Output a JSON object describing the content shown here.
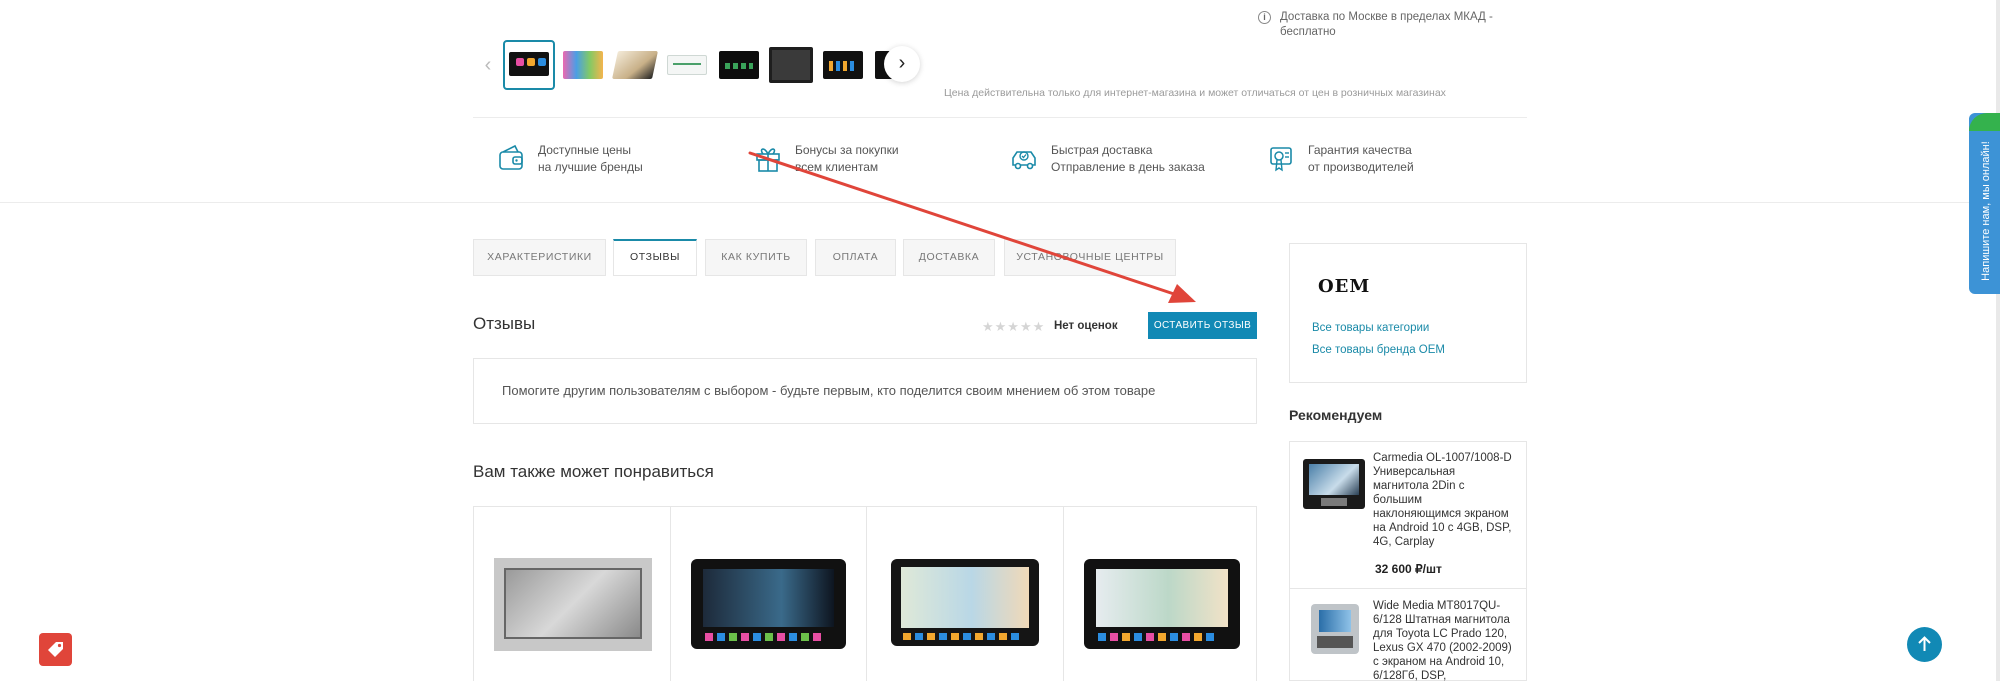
{
  "delivery": {
    "text": "Доставка по Москве в пределах МКАД - бесплатно"
  },
  "price_note": "Цена действительна только для интернет-магазина и может отличаться от цен в розничных магазинах",
  "advantages": [
    {
      "icon": "wallet-icon",
      "line1": "Доступные цены",
      "line2": "на лучшие бренды"
    },
    {
      "icon": "gift-icon",
      "line1": "Бонусы за покупки",
      "line2": "всем клиентам"
    },
    {
      "icon": "delivery-car-icon",
      "line1": "Быстрая доставка",
      "line2": "Отправление в день заказа"
    },
    {
      "icon": "quality-guarantee-icon",
      "line1": "Гарантия качества",
      "line2": "от производителей"
    }
  ],
  "tabs": [
    {
      "label": "ХАРАКТЕРИСТИКИ"
    },
    {
      "label": "ОТЗЫВЫ"
    },
    {
      "label": "КАК КУПИТЬ"
    },
    {
      "label": "ОПЛАТА"
    },
    {
      "label": "ДОСТАВКА"
    },
    {
      "label": "УСТАНОВОЧНЫЕ ЦЕНТРЫ"
    }
  ],
  "reviews": {
    "title": "Отзывы",
    "stars": "★★★★★",
    "no_ratings": "Нет оценок",
    "leave_button": "ОСТАВИТЬ ОТЗЫВ",
    "empty_text": "Помогите другим пользователям с выбором - будьте первым, кто поделится своим мнением об этом товаре"
  },
  "also_like": {
    "title": "Вам также может понравиться"
  },
  "brand": {
    "logo_text": "OEM",
    "links": [
      "Все товары категории",
      "Все товары бренда OEM"
    ]
  },
  "recommend": {
    "title": "Рекомендуем",
    "items": [
      {
        "name": "Carmedia OL-1007/1008-D Универсальная магнитола 2Din с большим наклоняющимся экраном на Android 10 с 4GB, DSP, 4G, Carplay",
        "price": "32 600 ₽/шт"
      },
      {
        "name": "Wide Media MT8017QU-6/128 Штатная магнитола для Toyota LC Prado 120, Lexus GX 470 (2002-2009) с экраном на Android 10, 6/128Гб, DSP,"
      }
    ]
  },
  "chat_tab": {
    "label": "Напишите нам, мы онлайн!"
  },
  "colors": {
    "accent": "#1189b5",
    "tab_active": "#1a8aa8",
    "arrow": "#e0453a",
    "chat": "#3d93d6",
    "chat_online": "#34b24d"
  }
}
